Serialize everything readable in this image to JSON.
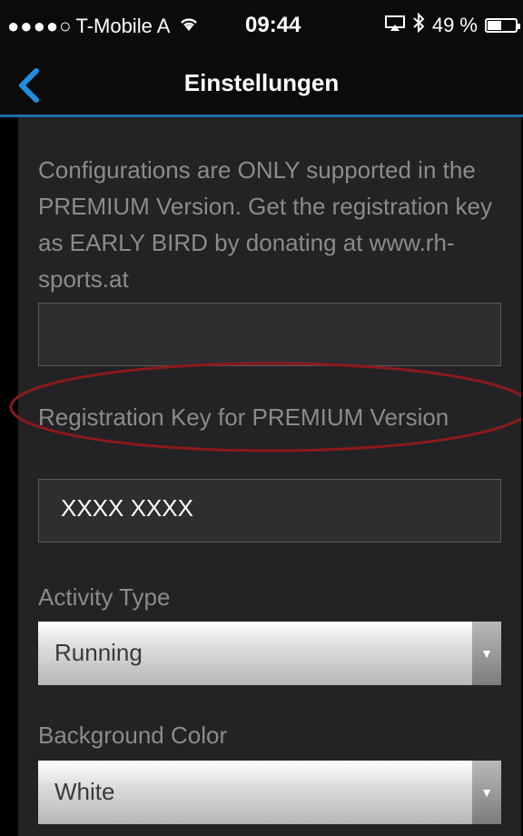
{
  "status_bar": {
    "carrier": "T-Mobile A",
    "time": "09:44",
    "battery_text": "49 %",
    "battery_level": 0.49,
    "icons": [
      "signal-dots-icon",
      "wifi-icon",
      "airplay-icon",
      "bluetooth-icon",
      "battery-icon"
    ]
  },
  "nav": {
    "title": "Einstellungen",
    "back_icon": "chevron-left-icon",
    "accent": "#1e8fe0"
  },
  "notice": {
    "text": "Configurations are ONLY supported in the PREMIUM Version. Get the registration key as EARLY BIRD by donating at www.rh-sports.at"
  },
  "fields": {
    "registration": {
      "label": "Registration Key for PREMIUM Version",
      "value": "XXXX XXXX",
      "highlight_color": "#8b1a1a"
    },
    "activity_type": {
      "label": "Activity Type",
      "value": "Running"
    },
    "background_color": {
      "label": "Background Color",
      "value": "White"
    }
  }
}
